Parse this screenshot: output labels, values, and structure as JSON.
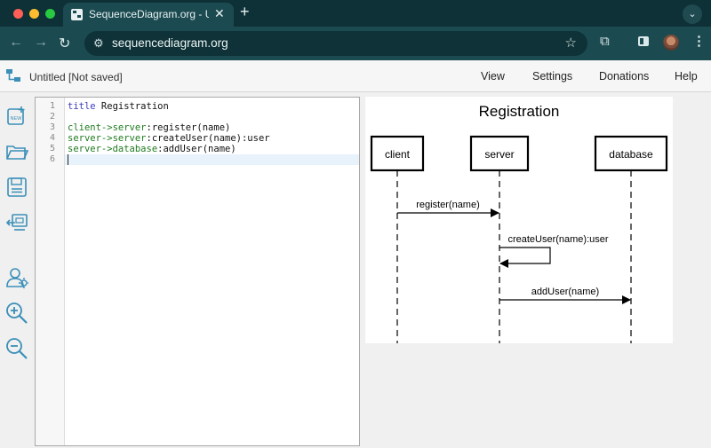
{
  "browser": {
    "tab_title": "SequenceDiagram.org - UML",
    "url": "sequencediagram.org"
  },
  "app": {
    "doc_title": "Untitled [Not saved]",
    "menu": [
      "View",
      "Settings",
      "Donations",
      "Help"
    ]
  },
  "tools": [
    "new-icon",
    "open-folder-icon",
    "save-icon",
    "export-icon",
    "participants-icon",
    "zoom-in-icon",
    "zoom-out-icon"
  ],
  "editor": {
    "line_numbers": [
      "1",
      "2",
      "3",
      "4",
      "5",
      "6"
    ],
    "lines": [
      "title Registration",
      "",
      "client->server:register(name)",
      "server->server:createUser(name):user",
      "server->database:addUser(name)",
      ""
    ]
  },
  "diagram": {
    "title": "Registration",
    "participants": [
      "client",
      "server",
      "database"
    ],
    "messages": [
      {
        "from": "client",
        "to": "server",
        "label": "register(name)"
      },
      {
        "from": "server",
        "to": "server",
        "label": "createUser(name):user"
      },
      {
        "from": "server",
        "to": "database",
        "label": "addUser(name)"
      }
    ]
  },
  "colors": {
    "browser_frame": "#0d3136",
    "browser_toolbar": "#1b4a50",
    "tool_icons": "#3a8fb7",
    "keyword": "#3b3bbf",
    "entity": "#1f7a1f"
  }
}
